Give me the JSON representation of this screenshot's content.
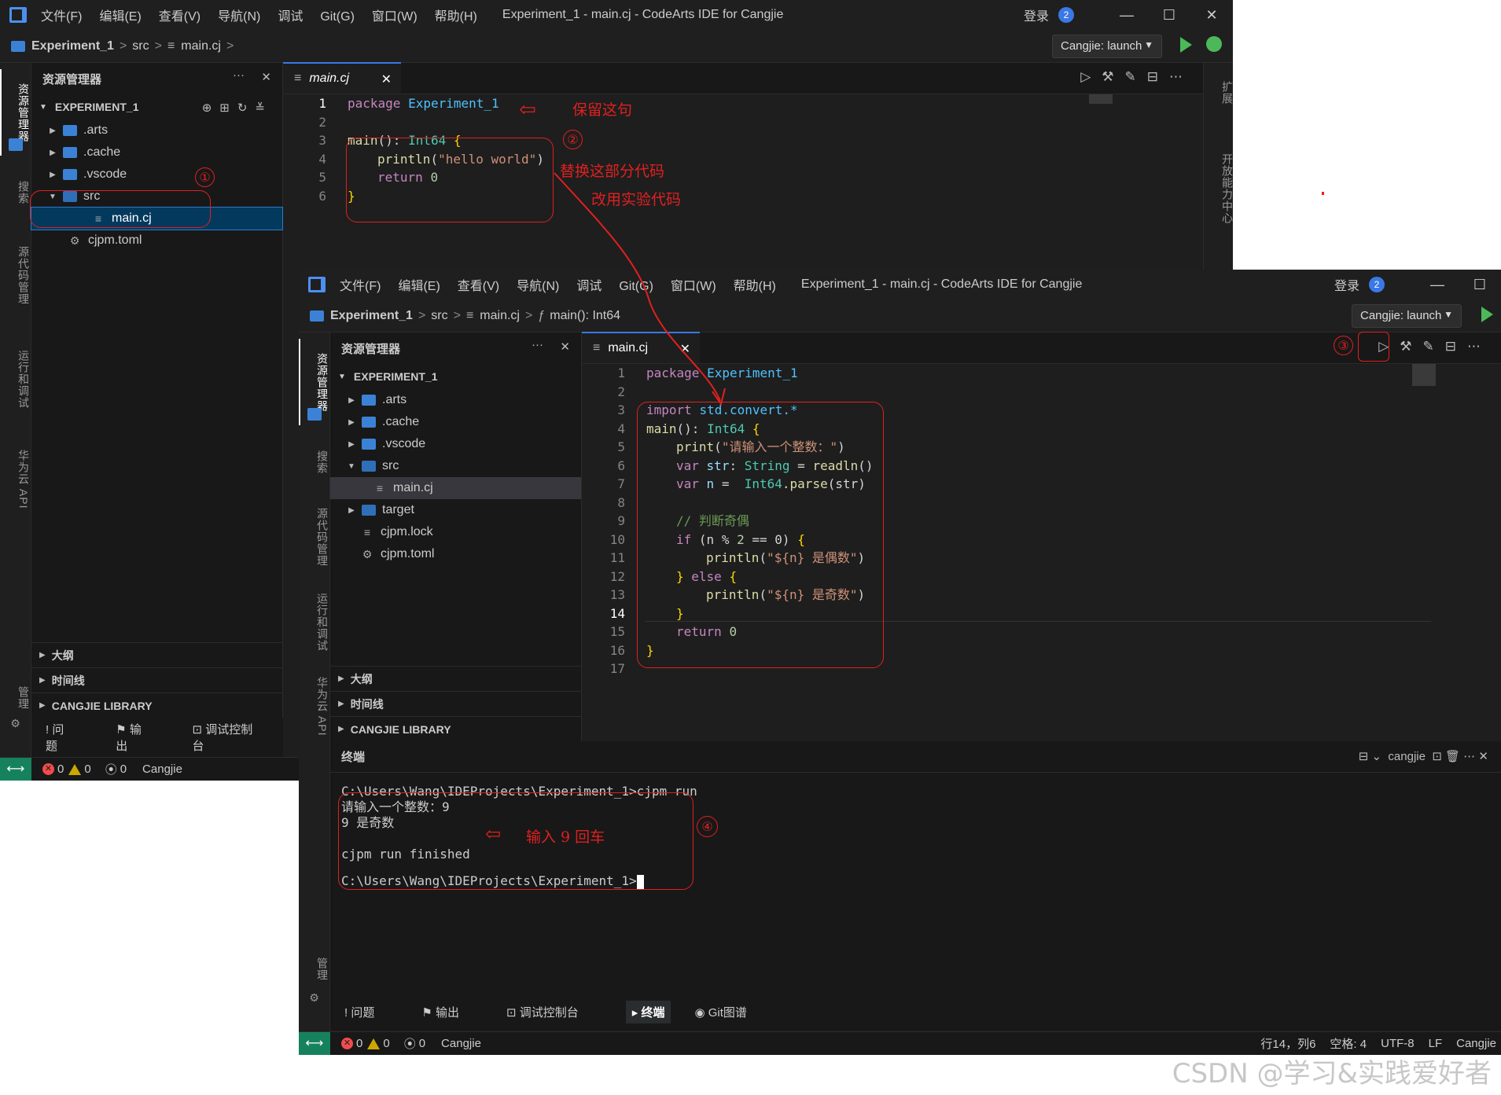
{
  "menu": [
    "文件(F)",
    "编辑(E)",
    "查看(V)",
    "导航(N)",
    "调试",
    "Git(G)",
    "窗口(W)",
    "帮助(H)"
  ],
  "window_title": "Experiment_1 - main.cj - CodeArts IDE for Cangjie",
  "login": "登录",
  "login_badge": "2",
  "crumbs1": {
    "project": "Experiment_1",
    "src": "src",
    "file": "main.cj"
  },
  "crumbs2": {
    "project": "Experiment_1",
    "src": "src",
    "file": "main.cj",
    "symbol": "main(): Int64"
  },
  "launch": "Cangjie: launch",
  "activity": {
    "explorer": "资源管理器",
    "search": "搜索",
    "scm": "源代码管理",
    "run": "运行和调试",
    "api": "华为云 API",
    "manage": "管理"
  },
  "right_bar": {
    "extensions": "扩展",
    "openability": "开放能力中心"
  },
  "explorer_title": "资源管理器",
  "project_name": "EXPERIMENT_1",
  "tree1": [
    ".arts",
    ".cache",
    ".vscode",
    "src",
    "main.cj",
    "cjpm.toml"
  ],
  "tree2": [
    ".arts",
    ".cache",
    ".vscode",
    "src",
    "main.cj",
    "target",
    "cjpm.lock",
    "cjpm.toml"
  ],
  "sections": [
    "大纲",
    "时间线",
    "CANGJIE LIBRARY"
  ],
  "panel_tabs1": [
    "问题",
    "输出",
    "调试控制台"
  ],
  "panel_tabs2": [
    "问题",
    "输出",
    "调试控制台",
    "终端",
    "Git图谱"
  ],
  "tab_file": "main.cj",
  "status": {
    "errors": "0",
    "warnings": "0",
    "ports": "0",
    "lang": "Cangjie",
    "pos": "行14，列6",
    "spaces": "空格: 4",
    "enc": "UTF-8",
    "eol": "LF",
    "mode": "Cangjie"
  },
  "code1_lines": [
    "1",
    "2",
    "3",
    "4",
    "5",
    "6"
  ],
  "code2_lines": [
    "1",
    "2",
    "3",
    "4",
    "5",
    "6",
    "7",
    "8",
    "9",
    "10",
    "11",
    "12",
    "13",
    "14",
    "15",
    "16",
    "17"
  ],
  "code1": {
    "l1a": "package",
    "l1b": "Experiment_1",
    "l3a": "main",
    "l3b": "():",
    "l3c": "Int64",
    "l3d": "{",
    "l4a": "println",
    "l4b": "(",
    "l4c": "\"hello world\"",
    "l4d": ")",
    "l5a": "return",
    "l5b": "0",
    "l6a": "}"
  },
  "code2": {
    "l1a": "package",
    "l1b": "Experiment_1",
    "l3a": "import",
    "l3b": "std.convert.*",
    "l4a": "main",
    "l4b": "():",
    "l4c": "Int64",
    "l4d": "{",
    "l5a": "print",
    "l5b": "(",
    "l5c": "\"请输入一个整数：\"",
    "l5d": ")",
    "l6a": "var",
    "l6b": "str",
    "l6c": ":",
    "l6d": "String",
    "l6e": "=",
    "l6f": "readln",
    "l6g": "()",
    "l7a": "var",
    "l7b": "n",
    "l7c": "=",
    "l7d": "Int64",
    "l7e": ".parse",
    "l7f": "(str)",
    "l9": "// 判断奇偶",
    "l10a": "if",
    "l10b": "(n",
    "l10c": "%",
    "l10d": "2",
    "l10e": "==",
    "l10f": "0)",
    "l10g": "{",
    "l11a": "println",
    "l11b": "(",
    "l11c": "\"${n} 是偶数\"",
    "l11d": ")",
    "l12a": "}",
    "l12b": "else",
    "l12c": "{",
    "l13a": "println",
    "l13b": "(",
    "l13c": "\"${n} 是奇数\"",
    "l13d": ")",
    "l14": "}",
    "l15a": "return",
    "l15b": "0",
    "l16": "}"
  },
  "terminal_title": "终端",
  "terminal_shell": "cangjie",
  "terminal_lines": [
    "C:\\Users\\Wang\\IDEProjects\\Experiment_1>cjpm run",
    "请输入一个整数：9",
    "9 是奇数",
    "",
    "cjpm run finished"
  ],
  "terminal_prompt": "C:\\Users\\Wang\\IDEProjects\\Experiment_1>",
  "annotations": {
    "keep": "保留这句",
    "replace": "替换这部分代码",
    "use_exp": "改用实验代码",
    "input9": "输入 9 回车",
    "n1": "①",
    "n2": "②",
    "n3": "③",
    "n4": "④"
  },
  "watermark": "CSDN @学习&实践爱好者"
}
